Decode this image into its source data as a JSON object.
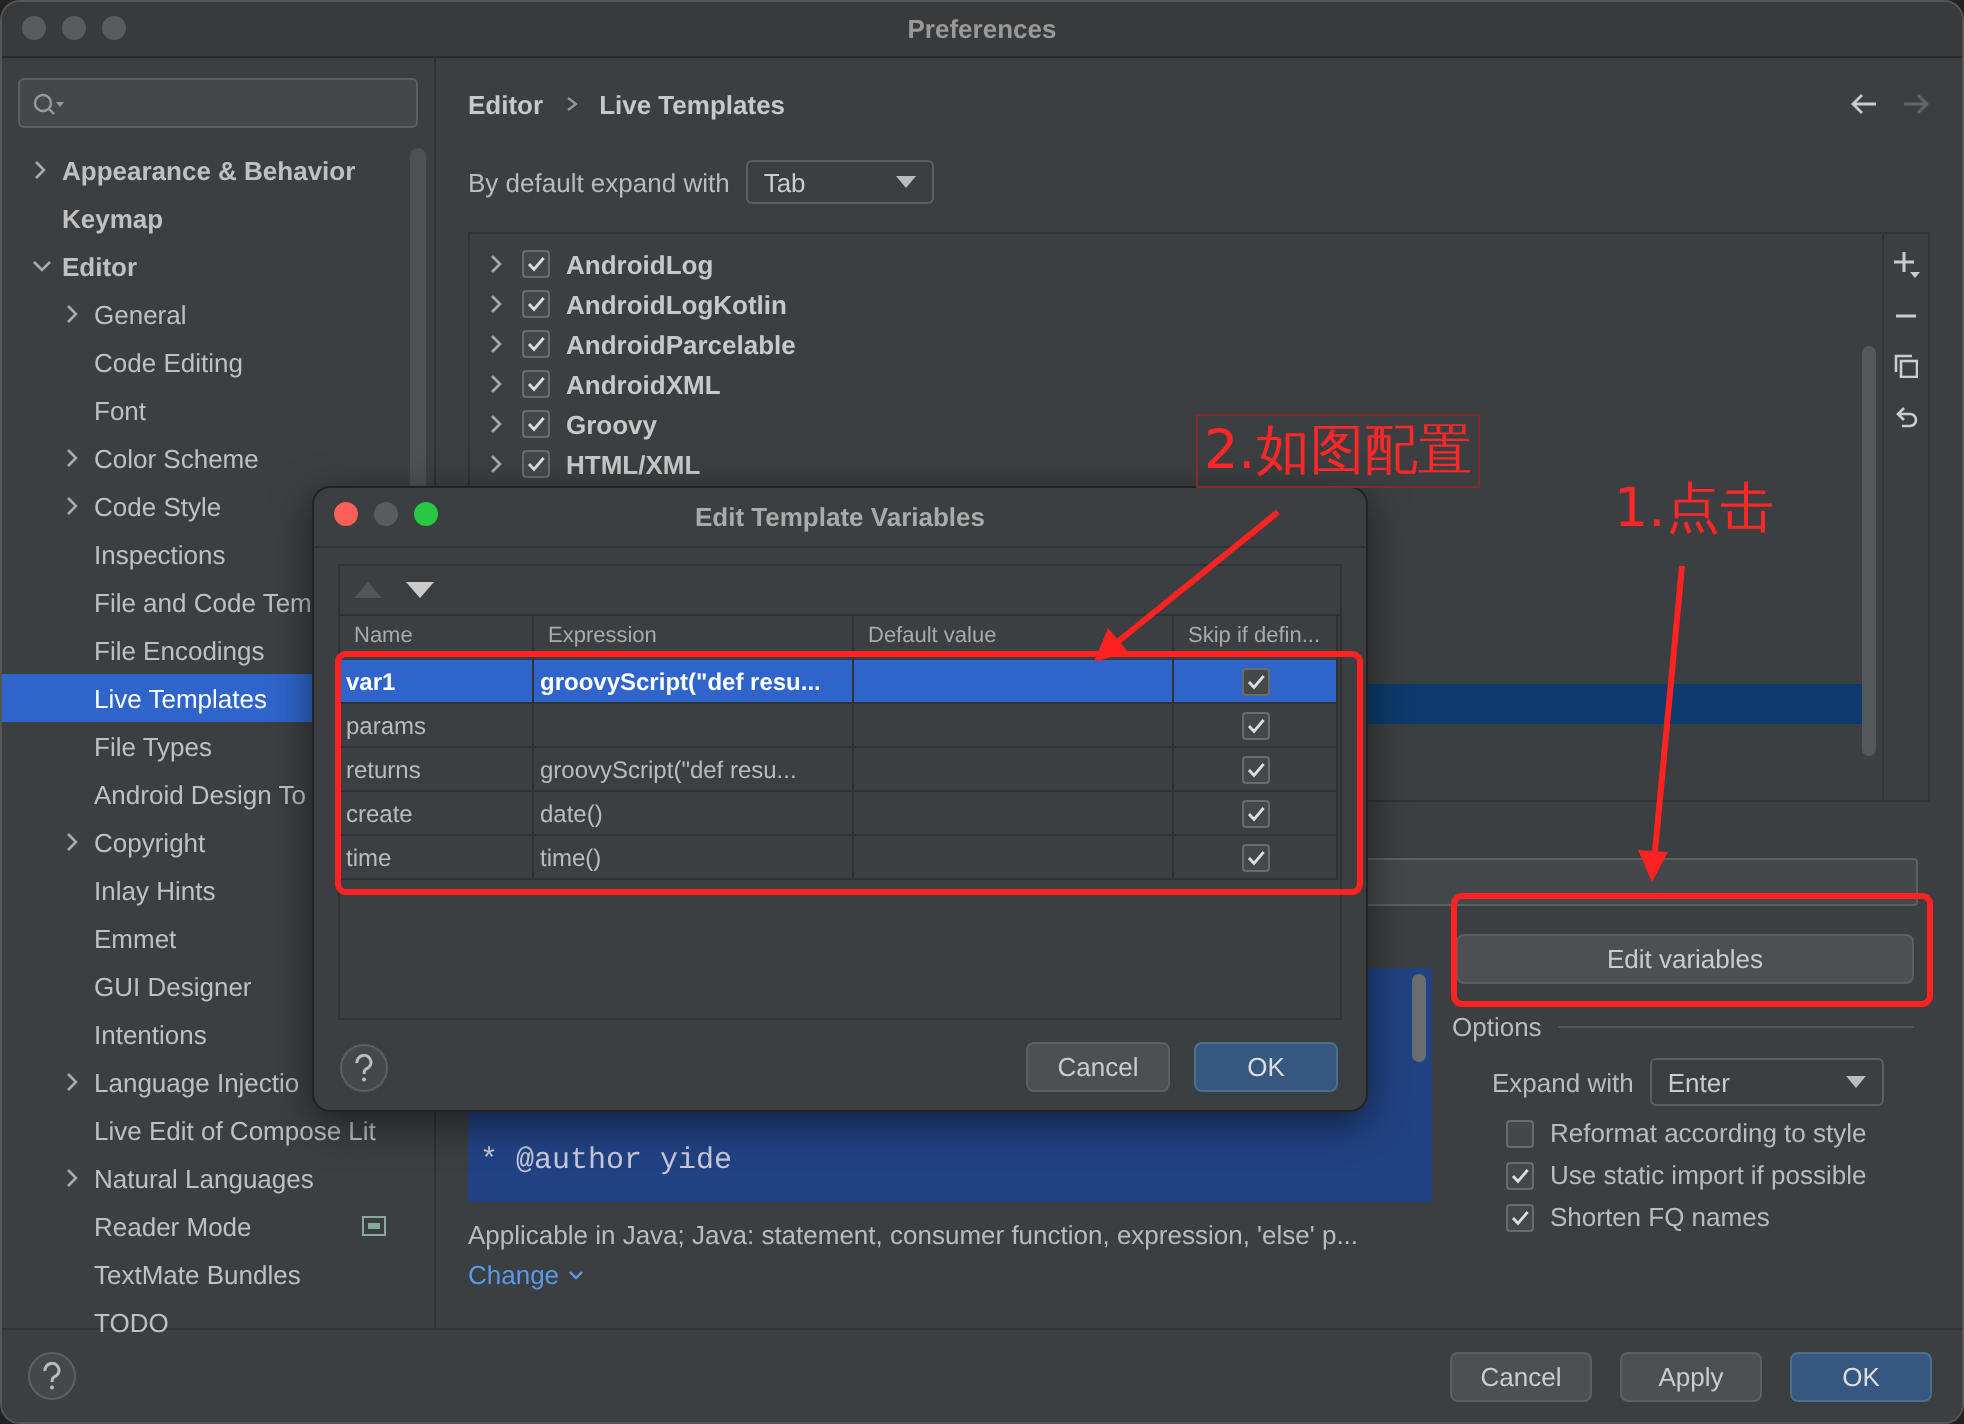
{
  "window": {
    "title": "Preferences"
  },
  "sidebar": {
    "items": [
      {
        "label": "Appearance & Behavior",
        "kind": "collapsed",
        "selected": false,
        "trailing_icon": false
      },
      {
        "label": "Keymap",
        "kind": "leaf",
        "selected": false,
        "trailing_icon": false
      },
      {
        "label": "Editor",
        "kind": "expanded",
        "selected": false,
        "trailing_icon": false,
        "children": [
          {
            "label": "General",
            "kind": "collapsed",
            "selected": false,
            "trailing_icon": false
          },
          {
            "label": "Code Editing",
            "kind": "leaf",
            "selected": false,
            "trailing_icon": false
          },
          {
            "label": "Font",
            "kind": "leaf",
            "selected": false,
            "trailing_icon": false
          },
          {
            "label": "Color Scheme",
            "kind": "collapsed",
            "selected": false,
            "trailing_icon": false
          },
          {
            "label": "Code Style",
            "kind": "collapsed",
            "selected": false,
            "trailing_icon": false
          },
          {
            "label": "Inspections",
            "kind": "leaf",
            "selected": false,
            "trailing_icon": false
          },
          {
            "label": "File and Code Tem",
            "kind": "leaf",
            "selected": false,
            "trailing_icon": false
          },
          {
            "label": "File Encodings",
            "kind": "leaf",
            "selected": false,
            "trailing_icon": false
          },
          {
            "label": "Live Templates",
            "kind": "leaf",
            "selected": true,
            "trailing_icon": false
          },
          {
            "label": "File Types",
            "kind": "leaf",
            "selected": false,
            "trailing_icon": false
          },
          {
            "label": "Android Design To",
            "kind": "leaf",
            "selected": false,
            "trailing_icon": false
          },
          {
            "label": "Copyright",
            "kind": "collapsed",
            "selected": false,
            "trailing_icon": false
          },
          {
            "label": "Inlay Hints",
            "kind": "leaf",
            "selected": false,
            "trailing_icon": false
          },
          {
            "label": "Emmet",
            "kind": "leaf",
            "selected": false,
            "trailing_icon": false
          },
          {
            "label": "GUI Designer",
            "kind": "leaf",
            "selected": false,
            "trailing_icon": false
          },
          {
            "label": "Intentions",
            "kind": "leaf",
            "selected": false,
            "trailing_icon": false
          },
          {
            "label": "Language Injectio",
            "kind": "collapsed",
            "selected": false,
            "trailing_icon": false
          },
          {
            "label": "Live Edit of Compose Lit",
            "kind": "leaf",
            "selected": false,
            "trailing_icon": false
          },
          {
            "label": "Natural Languages",
            "kind": "collapsed",
            "selected": false,
            "trailing_icon": false
          },
          {
            "label": "Reader Mode",
            "kind": "leaf",
            "selected": false,
            "trailing_icon": true
          },
          {
            "label": "TextMate Bundles",
            "kind": "leaf",
            "selected": false,
            "trailing_icon": false
          },
          {
            "label": "TODO",
            "kind": "leaf",
            "selected": false,
            "trailing_icon": false
          }
        ]
      }
    ]
  },
  "main": {
    "breadcrumb": [
      "Editor",
      "Live Templates"
    ],
    "expand_default": {
      "label": "By default expand with",
      "value": "Tab"
    },
    "templates": {
      "selected_row_visible": true,
      "items": [
        {
          "label": "AndroidLog",
          "checked": true,
          "expanded": false
        },
        {
          "label": "AndroidLogKotlin",
          "checked": true,
          "expanded": false
        },
        {
          "label": "AndroidParcelable",
          "checked": true,
          "expanded": false
        },
        {
          "label": "AndroidXML",
          "checked": true,
          "expanded": false
        },
        {
          "label": "Groovy",
          "checked": true,
          "expanded": false
        },
        {
          "label": "HTML/XML",
          "checked": true,
          "expanded": false
        }
      ]
    },
    "template_text": [
      "* @author yide"
    ],
    "applicable": "Applicable in Java; Java: statement, consumer function, expression, 'else' p...",
    "change_link": "Change",
    "edit_variables_button": "Edit variables",
    "options": {
      "title": "Options",
      "expand_label": "Expand with",
      "expand_value": "Enter",
      "checkboxes": [
        {
          "label": "Reformat according to style",
          "checked": false
        },
        {
          "label": "Use static import if possible",
          "checked": true
        },
        {
          "label": "Shorten FQ names",
          "checked": true
        }
      ]
    }
  },
  "footer": {
    "buttons": [
      {
        "label": "Cancel",
        "default": false
      },
      {
        "label": "Apply",
        "default": false
      },
      {
        "label": "OK",
        "default": true
      }
    ]
  },
  "dialog": {
    "title": "Edit Template Variables",
    "columns": [
      "Name",
      "Expression",
      "Default value",
      "Skip if defin..."
    ],
    "rows": [
      {
        "name": "var1",
        "expression": "groovyScript(\"def resu...",
        "skip": true,
        "selected": true
      },
      {
        "name": "params",
        "skip": true,
        "selected": false
      },
      {
        "name": "returns",
        "expression": "groovyScript(\"def resu...",
        "skip": true,
        "selected": false
      },
      {
        "name": "create",
        "expression": "date()",
        "skip": true,
        "selected": false
      },
      {
        "name": "time",
        "expression": "time()",
        "skip": true,
        "selected": false
      }
    ],
    "buttons": [
      {
        "label": "Cancel",
        "default": false
      },
      {
        "label": "OK",
        "default": true
      }
    ]
  },
  "annotations": [
    {
      "text": "2.如图配置",
      "boxed": true
    },
    {
      "text": "1.点击",
      "boxed": false
    }
  ]
}
